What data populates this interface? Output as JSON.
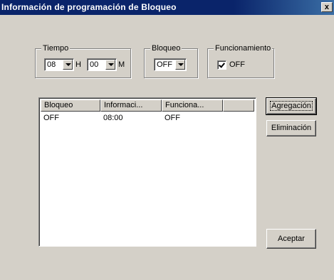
{
  "window": {
    "title": "Información de programación de Bloqueo",
    "close_glyph": "x"
  },
  "tiempo": {
    "label": "Tiempo",
    "hour_value": "08",
    "hour_unit": "H",
    "minute_value": "00",
    "minute_unit": "M"
  },
  "bloqueo": {
    "label": "Bloqueo",
    "value": "OFF"
  },
  "funcionamiento": {
    "label": "Funcionamiento",
    "checked": true,
    "checkbox_label": "OFF"
  },
  "list": {
    "columns": [
      "Bloqueo",
      "Informaci...",
      "Funciona...",
      ""
    ],
    "rows": [
      [
        "OFF",
        "08:00",
        "OFF"
      ]
    ]
  },
  "buttons": {
    "add": "Agregación",
    "delete": "Eliminación",
    "accept": "Aceptar"
  }
}
